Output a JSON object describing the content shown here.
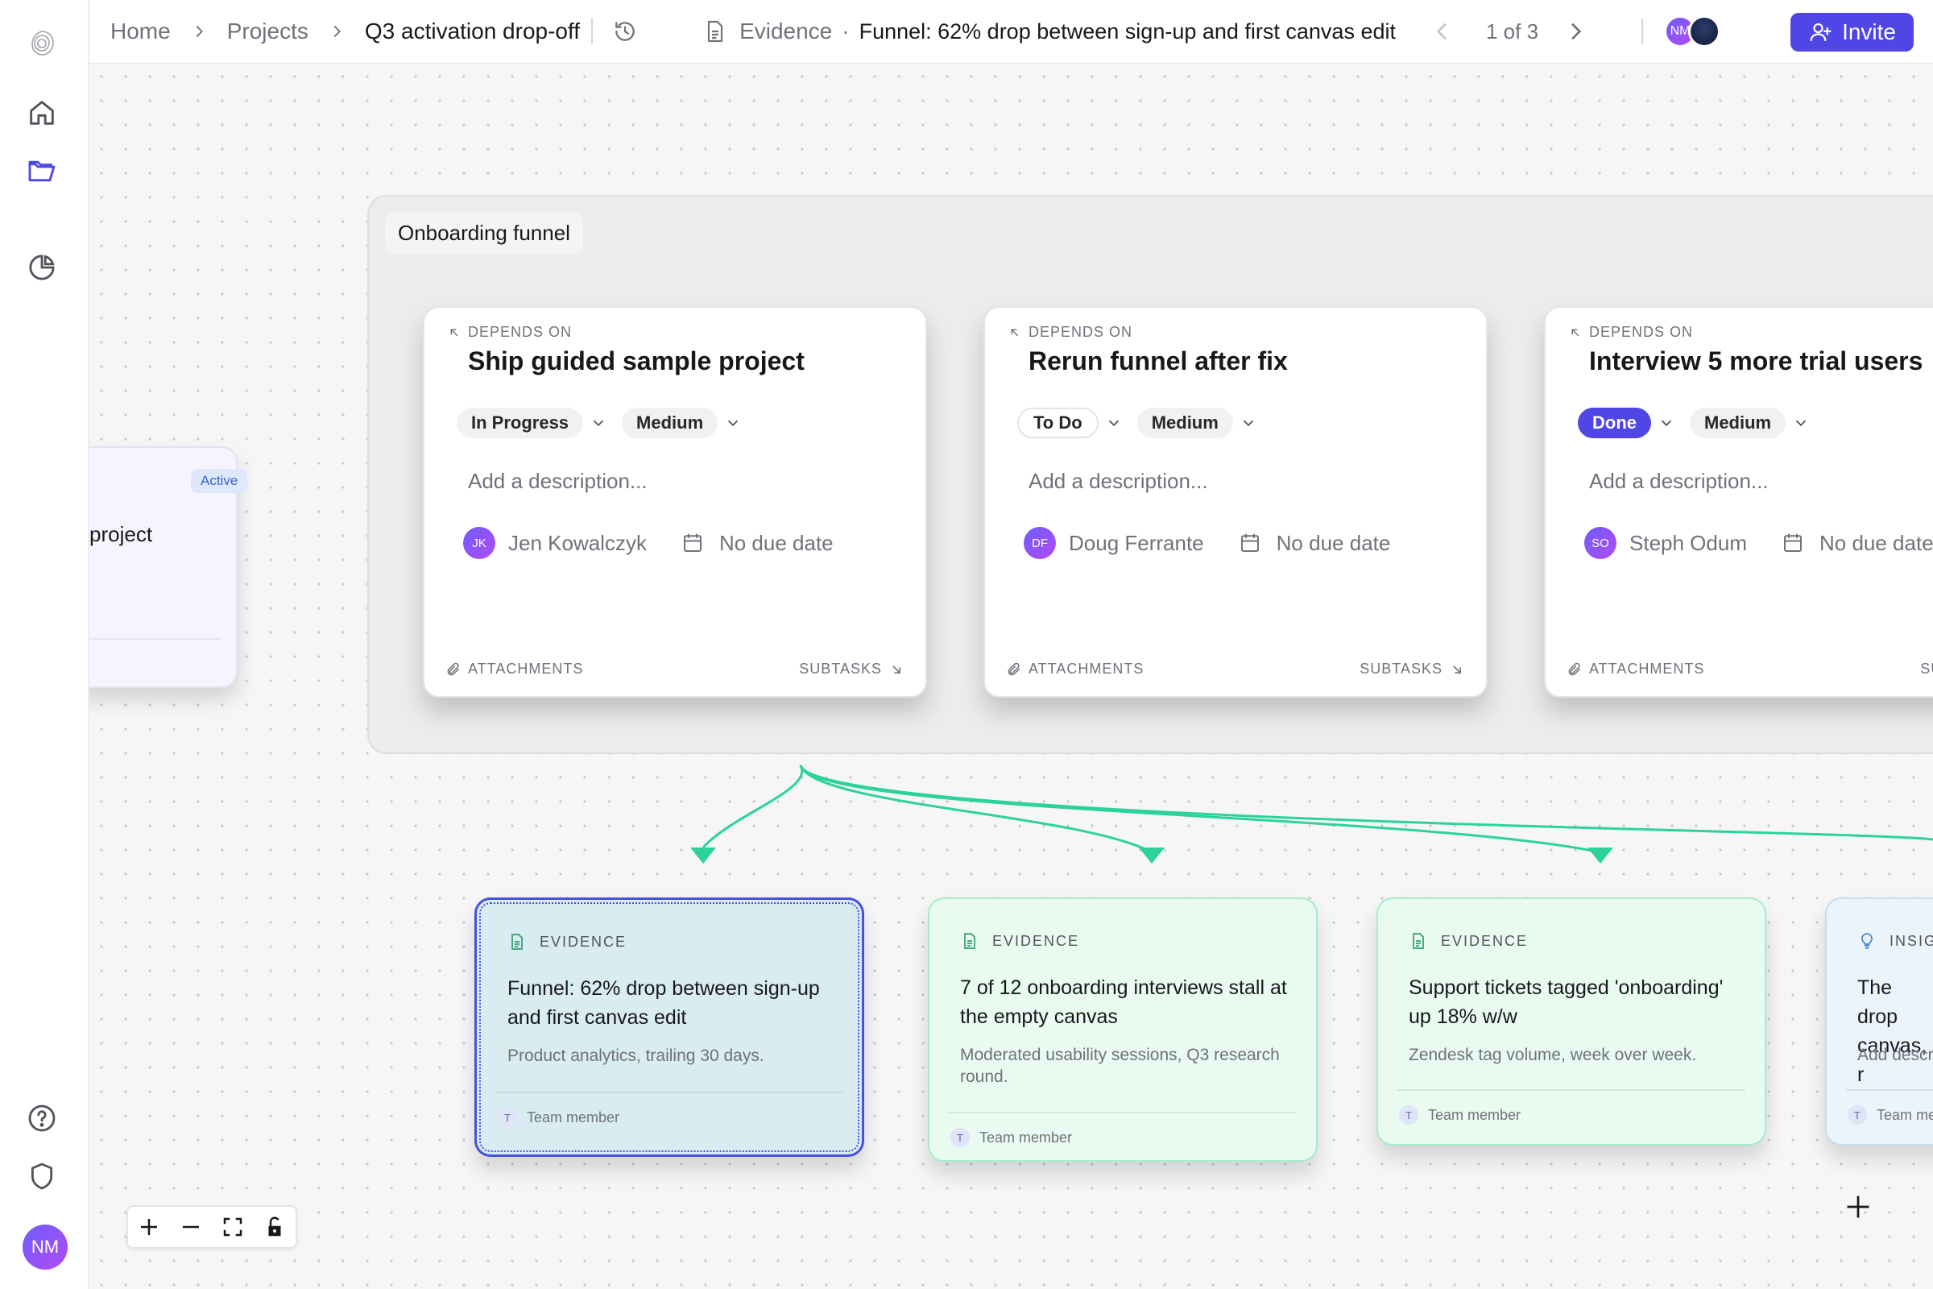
{
  "breadcrumb": {
    "home": "Home",
    "projects": "Projects",
    "current": "Q3 activation drop-off"
  },
  "evidence_header": {
    "type_label": "Evidence",
    "dot": "·",
    "title": "Funnel: 62% drop between sign-up and first canvas edit",
    "pager": "1 of 3"
  },
  "header": {
    "avatar_initials": "NM",
    "invite_label": "Invite"
  },
  "sidebar": {
    "user_initials": "NM"
  },
  "canvas": {
    "group_label": "Onboarding funnel",
    "side_card": {
      "badge": "Active",
      "title": "project"
    },
    "tasks": [
      {
        "kicker": "DEPENDS ON",
        "title": "Ship guided sample project",
        "status": "In Progress",
        "priority": "Medium",
        "description_placeholder": "Add a description...",
        "assignee_initials": "JK",
        "assignee": "Jen Kowalczyk",
        "due": "No due date",
        "attachments": "ATTACHMENTS",
        "subtasks": "SUBTASKS"
      },
      {
        "kicker": "DEPENDS ON",
        "title": "Rerun funnel after fix",
        "status": "To Do",
        "priority": "Medium",
        "description_placeholder": "Add a description...",
        "assignee_initials": "DF",
        "assignee": "Doug Ferrante",
        "due": "No due date",
        "attachments": "ATTACHMENTS",
        "subtasks": "SUBTASKS"
      },
      {
        "kicker": "DEPENDS ON",
        "title": "Interview 5 more trial users",
        "status": "Done",
        "priority": "Medium",
        "description_placeholder": "Add a description...",
        "assignee_initials": "SO",
        "assignee": "Steph Odum",
        "due": "No due date",
        "attachments": "ATTACHMENTS",
        "subtasks": "SUBTASKS"
      }
    ],
    "evidence": [
      {
        "kicker": "EVIDENCE",
        "title": "Funnel: 62% drop between sign-up and first canvas edit",
        "subtitle": "Product analytics, trailing 30 days.",
        "author_initial": "T",
        "author": "Team member"
      },
      {
        "kicker": "EVIDENCE",
        "title": "7 of 12 onboarding interviews stall at the empty canvas",
        "subtitle": "Moderated usability sessions, Q3 research round.",
        "author_initial": "T",
        "author": "Team member"
      },
      {
        "kicker": "EVIDENCE",
        "title": "Support tickets tagged 'onboarding' up 18% w/w",
        "subtitle": "Zendesk tag volume, week over week.",
        "author_initial": "T",
        "author": "Team member"
      },
      {
        "kicker": "INSIG",
        "title": "The drop canvas, r",
        "subtitle": "Add descr",
        "author_initial": "T",
        "author": "Team me"
      }
    ]
  },
  "colors": {
    "accent": "#4f46e5",
    "edge": "#2bd39a",
    "evidence_bg": "#e9faf1",
    "selected_bg": "#d9ecf2"
  }
}
